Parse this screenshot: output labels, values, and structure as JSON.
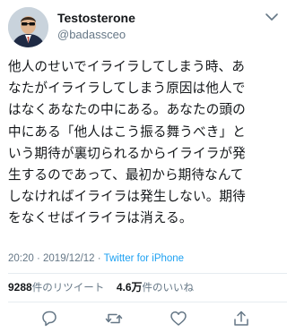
{
  "tweet": {
    "author": {
      "display_name": "Testosterone",
      "handle": "@badassceo"
    },
    "text": "他人のせいでイライラしてしまう時、あ\nなたがイライラしてしまう原因は他人で\nはなくあなたの中にある。あなたの頭の\n中にある「他人はこう振る舞うべき」と\nいう期待が裏切られるからイライラが発\n生するのであって、最初から期待なんて\nしなければイライラは発生しない。期待\nをなくせばイライラは消える。",
    "time": "20:20",
    "separator": " · ",
    "date": "2019/12/12",
    "source": "Twitter for iPhone",
    "retweets": {
      "count": "9288",
      "label": "件のリツイート"
    },
    "likes": {
      "count": "4.6万",
      "label": "件のいいね"
    }
  },
  "icons": [
    "more-icon",
    "reply-icon",
    "retweet-icon",
    "like-icon",
    "share-icon"
  ],
  "colors": {
    "text": "#14171a",
    "secondary": "#657786",
    "link": "#1da1f2",
    "divider": "#e6ecf0"
  }
}
